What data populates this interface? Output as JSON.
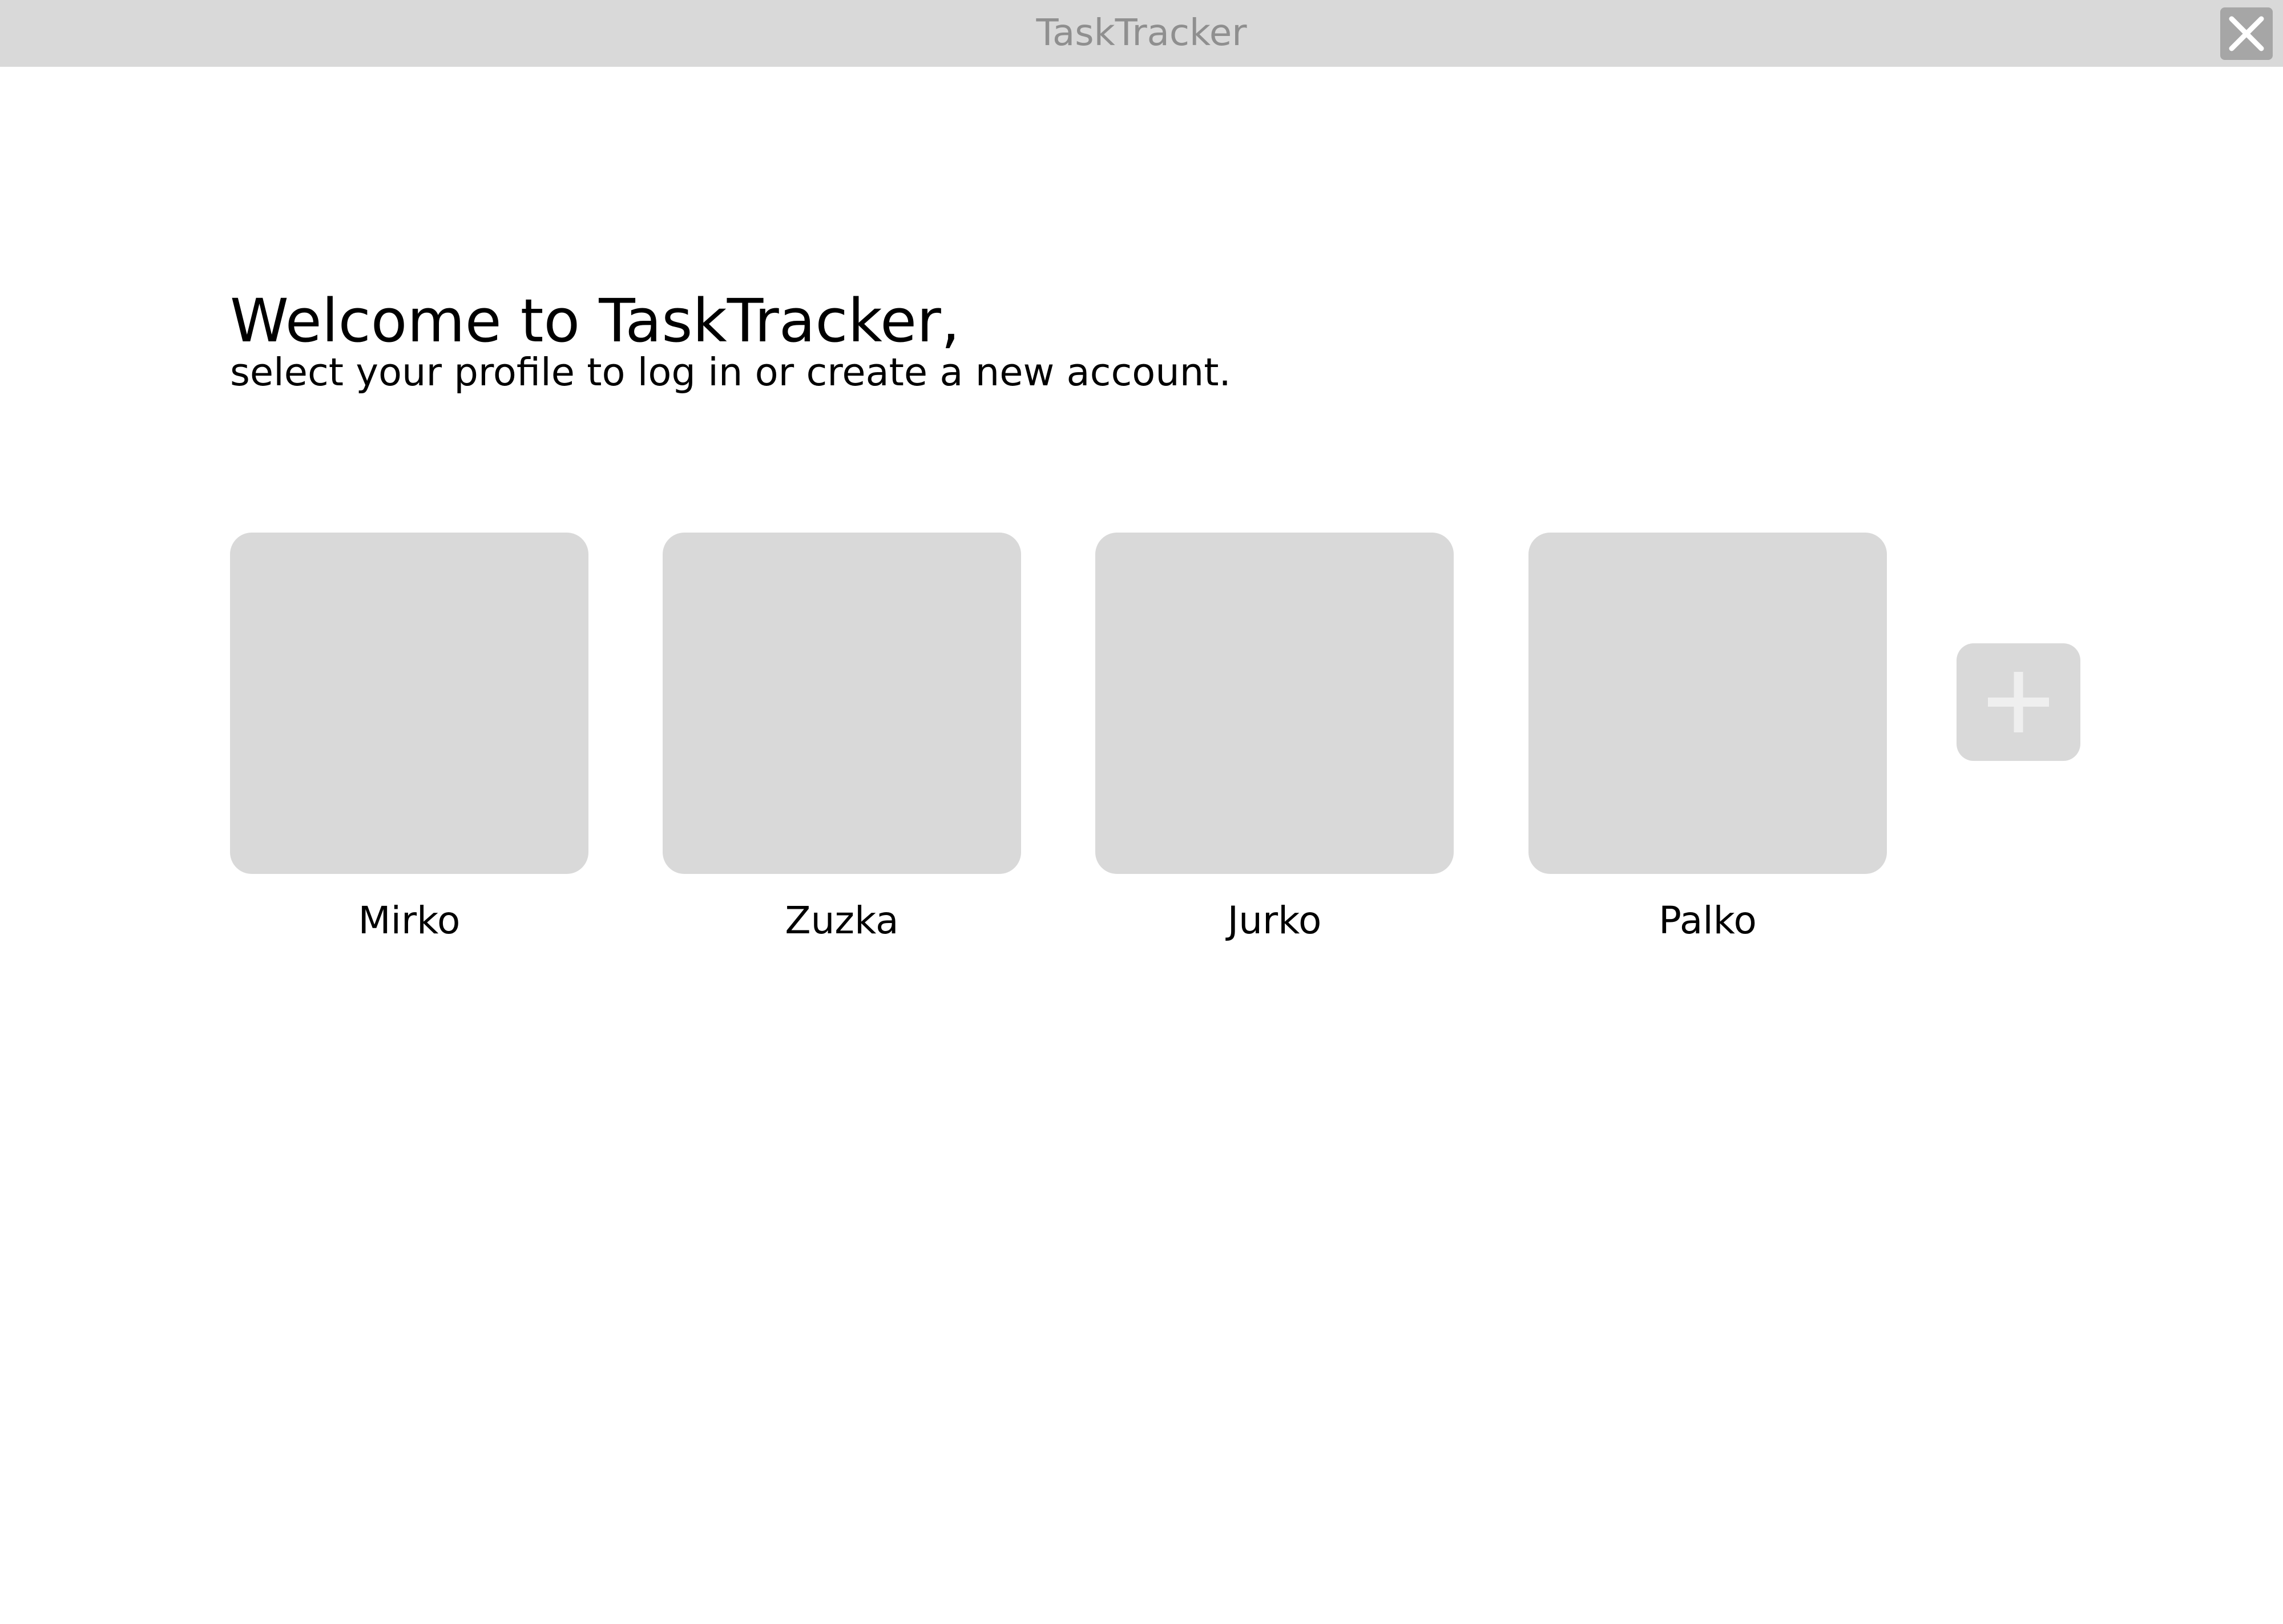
{
  "window": {
    "title": "TaskTracker",
    "close_icon": "close-icon"
  },
  "welcome": {
    "heading": "Welcome to TaskTracker,",
    "subtitle": "select your profile to log in or create a new account."
  },
  "profiles": [
    {
      "name": "Mirko"
    },
    {
      "name": "Zuzka"
    },
    {
      "name": "Jurko"
    },
    {
      "name": "Palko"
    }
  ],
  "add_profile": {
    "icon": "plus-icon"
  },
  "colors": {
    "titlebar": "#d9d9d9",
    "title_text": "#8f8f8f",
    "card": "#d9d9d9",
    "close_button": "#a6a6a6",
    "text": "#000000"
  }
}
